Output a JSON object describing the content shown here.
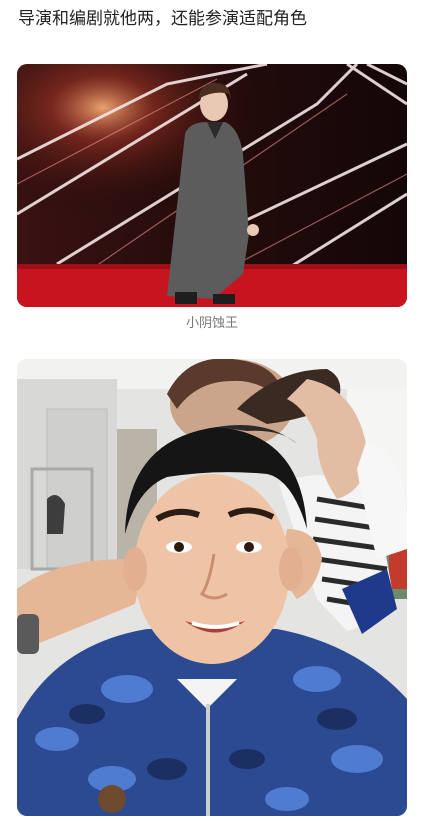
{
  "post": {
    "headline": "导演和编剧就他两，还能参演适配角色",
    "images": [
      {
        "caption": "小阴蚀王"
      },
      {
        "caption": ""
      }
    ]
  },
  "colors": {
    "stage_red": "#c8141e",
    "hoodie_camo": "#2b4a92"
  },
  "icons": []
}
